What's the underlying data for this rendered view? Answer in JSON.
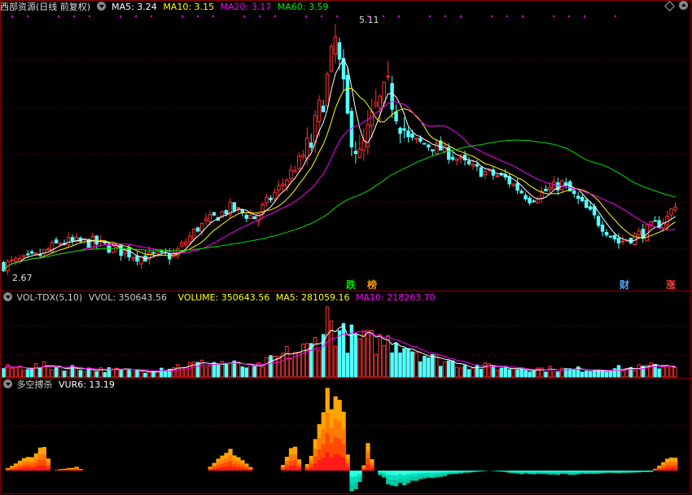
{
  "header": {
    "title": "西部资源(日线 前复权)",
    "ma": [
      {
        "label": "MA5: 3.24",
        "color": "#ffffff"
      },
      {
        "label": "MA10: 3.15",
        "color": "#ffff00"
      },
      {
        "label": "MA20: 3.17",
        "color": "#ff00ff"
      },
      {
        "label": "MA60: 3.59",
        "color": "#00e000"
      }
    ]
  },
  "price_panel": {
    "high_label": "5.11",
    "low_label": "2.67",
    "ylim": [
      2.5,
      5.25
    ],
    "markers": [
      {
        "text": "跌",
        "color": "#00e000"
      },
      {
        "text": "榜",
        "color": "#ff9900"
      },
      {
        "text": "财",
        "color": "#4da6ff"
      },
      {
        "text": "涨",
        "color": "#ff4040"
      }
    ]
  },
  "volume_panel": {
    "indicator": "VOL-TDX(5,10)",
    "vvol": "VVOL: 350643.56",
    "volume": "VOLUME: 350643.56",
    "ma5": "MA5: 281059.16",
    "ma10": "MA10: 218263.70",
    "colors": {
      "indicator": "#cccccc",
      "vvol": "#cccccc",
      "volume": "#ffff00",
      "ma5": "#ffff00",
      "ma10": "#ff00ff"
    }
  },
  "bull_bear_panel": {
    "name": "多空搏杀",
    "vur6": "VUR6: 13.19",
    "colors": {
      "name": "#cccccc",
      "vur6": "#ffffff"
    }
  },
  "colors": {
    "up": "#ff3232",
    "down": "#54ffff",
    "ma5": "#ffffff",
    "ma10": "#ffff00",
    "ma20": "#ff00ff",
    "ma60": "#00e000",
    "grid": "#8b0000"
  },
  "chart_data": {
    "type": "candlestick",
    "anchors": [
      [
        0,
        2.72
      ],
      [
        8,
        2.8
      ],
      [
        14,
        2.95
      ],
      [
        22,
        2.95
      ],
      [
        34,
        2.8
      ],
      [
        42,
        2.82
      ],
      [
        48,
        3.1
      ],
      [
        56,
        3.3
      ],
      [
        62,
        3.2
      ],
      [
        70,
        3.6
      ],
      [
        76,
        3.95
      ],
      [
        80,
        4.6
      ],
      [
        82,
        5.0
      ],
      [
        85,
        4.2
      ],
      [
        88,
        3.8
      ],
      [
        92,
        4.3
      ],
      [
        95,
        4.5
      ],
      [
        100,
        4.0
      ],
      [
        108,
        3.9
      ],
      [
        116,
        3.7
      ],
      [
        124,
        3.6
      ],
      [
        130,
        3.4
      ],
      [
        138,
        3.55
      ],
      [
        146,
        3.2
      ],
      [
        152,
        2.95
      ],
      [
        158,
        3.05
      ],
      [
        164,
        3.2
      ],
      [
        166,
        3.35
      ]
    ],
    "volume_anchors": [
      [
        0,
        0.12
      ],
      [
        10,
        0.15
      ],
      [
        24,
        0.1
      ],
      [
        34,
        0.08
      ],
      [
        44,
        0.16
      ],
      [
        54,
        0.2
      ],
      [
        62,
        0.12
      ],
      [
        70,
        0.32
      ],
      [
        76,
        0.4
      ],
      [
        80,
        0.8
      ],
      [
        84,
        0.55
      ],
      [
        90,
        0.48
      ],
      [
        98,
        0.5
      ],
      [
        106,
        0.25
      ],
      [
        116,
        0.15
      ],
      [
        126,
        0.12
      ],
      [
        140,
        0.1
      ],
      [
        156,
        0.12
      ],
      [
        166,
        0.18
      ]
    ],
    "vur_anchors": [
      [
        0,
        0
      ],
      [
        10,
        0.3
      ],
      [
        12,
        0
      ],
      [
        18,
        0.05
      ],
      [
        20,
        0
      ],
      [
        50,
        0
      ],
      [
        56,
        0.28
      ],
      [
        62,
        0
      ],
      [
        68,
        0
      ],
      [
        72,
        0.35
      ],
      [
        74,
        0
      ],
      [
        76,
        0.2
      ],
      [
        80,
        1.0
      ],
      [
        84,
        0.8
      ],
      [
        86,
        -0.35
      ],
      [
        88,
        -0.2
      ],
      [
        90,
        0.35
      ],
      [
        92,
        0
      ],
      [
        96,
        -0.25
      ],
      [
        104,
        -0.12
      ],
      [
        112,
        -0.05
      ],
      [
        120,
        0
      ],
      [
        128,
        -0.05
      ],
      [
        140,
        -0.06
      ],
      [
        160,
        -0.02
      ],
      [
        164,
        0.15
      ],
      [
        166,
        0.19
      ]
    ]
  }
}
